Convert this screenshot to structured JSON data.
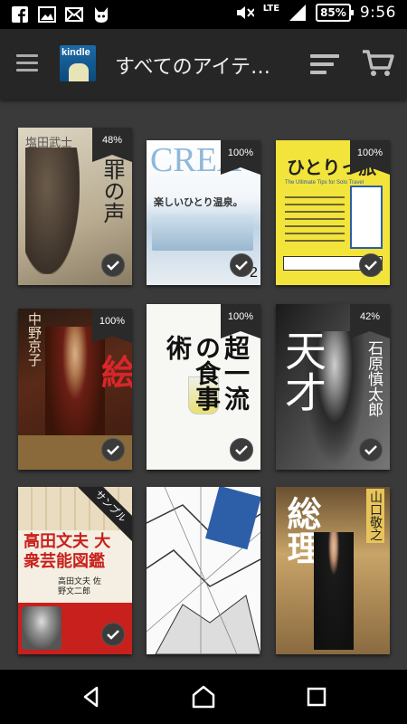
{
  "status_bar": {
    "lte": "LTE",
    "battery": "85%",
    "time": "9:56",
    "left_icons": [
      "facebook-icon",
      "image-icon",
      "mail-icon",
      "cat-app-icon"
    ],
    "right_icons": [
      "mute-icon",
      "signal-icon"
    ]
  },
  "app_bar": {
    "logo_text": "kindle",
    "title": "すべてのアイテ…"
  },
  "colors": {
    "background": "#3a3a3a",
    "app_bar": "#262626",
    "badge": "#2a2a2a"
  },
  "books": [
    {
      "progress": "48%",
      "downloaded": true,
      "title": "罪の声",
      "author": "塩田武士"
    },
    {
      "progress": "100%",
      "downloaded": true,
      "magazine": "CREA",
      "headline": "楽しいひとり温泉。",
      "issue": "2"
    },
    {
      "progress": "100%",
      "downloaded": true,
      "title": "ひとりっ旅",
      "subtitle": "The Ultimate Tips for Solo Travel"
    },
    {
      "progress": "100%",
      "downloaded": true,
      "title": "絵",
      "author": "中野京子"
    },
    {
      "progress": "100%",
      "downloaded": true,
      "title": "超一流の食事術"
    },
    {
      "progress": "42%",
      "downloaded": true,
      "title": "天才",
      "author": "石原慎太郎"
    },
    {
      "progress": "",
      "downloaded": true,
      "title": "高田文夫 大衆芸能図鑑",
      "tag": "サンプル",
      "authors": "高田文夫 佐野文二郎"
    },
    {
      "progress": "",
      "downloaded": false,
      "title": ""
    },
    {
      "progress": "",
      "downloaded": false,
      "title": "総理",
      "author": "山口敬之"
    }
  ],
  "nav_bar": {
    "buttons": [
      "back-icon",
      "home-icon",
      "recents-icon"
    ]
  }
}
